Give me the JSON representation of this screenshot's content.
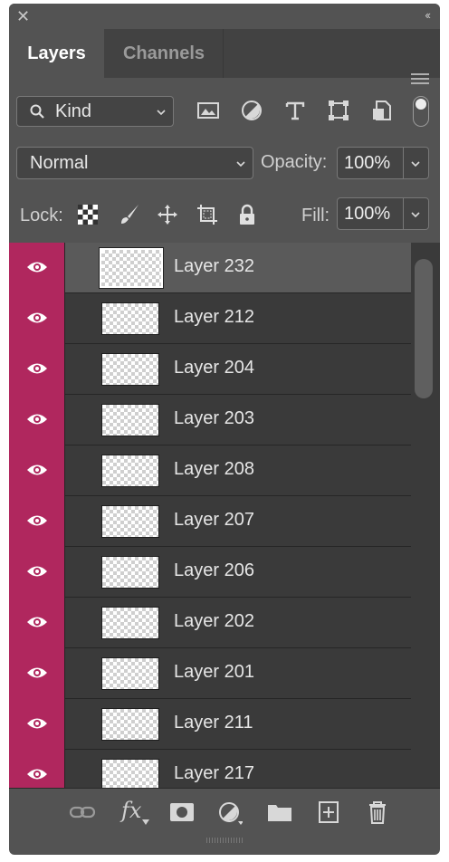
{
  "tabs": [
    {
      "label": "Layers",
      "active": true
    },
    {
      "label": "Channels",
      "active": false
    }
  ],
  "filter": {
    "kind_label": "Kind"
  },
  "blend": {
    "mode": "Normal",
    "opacity_label": "Opacity:",
    "opacity_value": "100%"
  },
  "lock": {
    "label": "Lock:",
    "fill_label": "Fill:",
    "fill_value": "100%"
  },
  "layers": [
    {
      "name": "Layer 232",
      "selected": true
    },
    {
      "name": "Layer 212"
    },
    {
      "name": "Layer 204"
    },
    {
      "name": "Layer 203"
    },
    {
      "name": "Layer 208"
    },
    {
      "name": "Layer 207"
    },
    {
      "name": "Layer 206"
    },
    {
      "name": "Layer 202"
    },
    {
      "name": "Layer 201"
    },
    {
      "name": "Layer 211"
    },
    {
      "name": "Layer 217"
    }
  ],
  "colors": {
    "visibility_cell": "#b0275e",
    "panel": "#535353",
    "list_bg": "#3a3a3a"
  },
  "icons": {
    "filter": [
      "image-filter-icon",
      "adjustment-filter-icon",
      "type-filter-icon",
      "shape-filter-icon",
      "smart-object-filter-icon"
    ],
    "lock": [
      "lock-transparent-pixels-icon",
      "lock-image-pixels-icon",
      "lock-position-icon",
      "lock-artboard-icon",
      "lock-all-icon"
    ],
    "footer": [
      "link-layers-icon",
      "fx-icon",
      "layer-mask-icon",
      "adjustment-layer-icon",
      "group-folder-icon",
      "new-layer-icon",
      "trash-icon"
    ]
  }
}
